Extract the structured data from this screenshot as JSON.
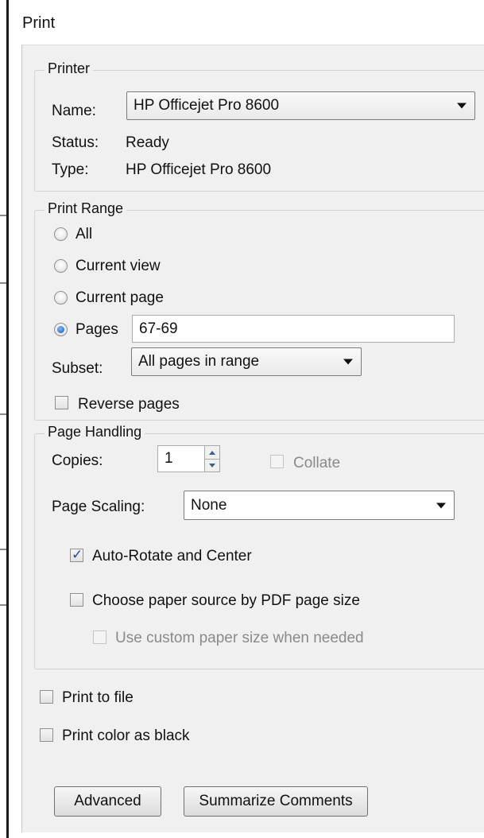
{
  "window": {
    "title": "Print"
  },
  "printer": {
    "legend": "Printer",
    "name_label": "Name:",
    "name_value": "HP Officejet Pro 8600",
    "status_label": "Status:",
    "status_value": "Ready",
    "type_label": "Type:",
    "type_value": "HP Officejet Pro 8600"
  },
  "print_range": {
    "legend": "Print Range",
    "options": [
      {
        "label": "All",
        "selected": false
      },
      {
        "label": "Current view",
        "selected": false
      },
      {
        "label": "Current page",
        "selected": false
      },
      {
        "label": "Pages",
        "selected": true
      }
    ],
    "pages_value": "67-69",
    "subset_label": "Subset:",
    "subset_value": "All pages in range",
    "reverse_label": "Reverse pages",
    "reverse_checked": false
  },
  "page_handling": {
    "legend": "Page Handling",
    "copies_label": "Copies:",
    "copies_value": "1",
    "collate_label": "Collate",
    "collate_checked": false,
    "scaling_label": "Page Scaling:",
    "scaling_value": "None",
    "auto_rotate_label": "Auto-Rotate and Center",
    "auto_rotate_checked": true,
    "paper_source_label": "Choose paper source by PDF page size",
    "paper_source_checked": false,
    "custom_paper_label": "Use custom paper size when needed",
    "custom_paper_checked": false
  },
  "options": {
    "print_to_file_label": "Print to file",
    "print_to_file_checked": false,
    "print_black_label": "Print color as black",
    "print_black_checked": false
  },
  "buttons": {
    "advanced": "Advanced",
    "summarize": "Summarize Comments"
  }
}
